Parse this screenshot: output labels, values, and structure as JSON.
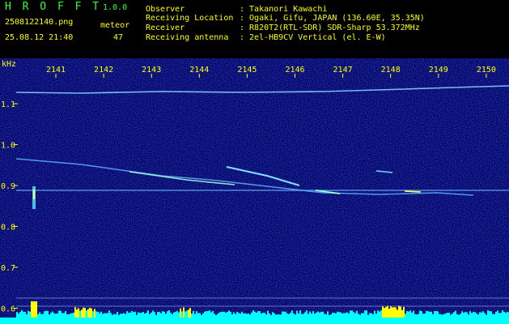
{
  "app": {
    "name": "H R O F F T",
    "version": "1.0.0",
    "file": "2508122140.png",
    "datetime": "25.08.12 21:40",
    "counter_label": "meteor",
    "counter_value": "47"
  },
  "info": [
    {
      "label": "Observer",
      "value": ": Takanori Kawachi"
    },
    {
      "label": "Receiving Location",
      "value": ": Ogaki, Gifu, JAPAN (136.60E, 35.35N)"
    },
    {
      "label": "Receiver",
      "value": ": R820T2(RTL-SDR) SDR-Sharp 53.372MHz"
    },
    {
      "label": "Receiving antenna",
      "value": ": 2el-HB9CV Vertical (el. E-W)"
    }
  ],
  "axis": {
    "unit": "kHz",
    "y_ticks": [
      "1.1",
      "1.0",
      "0.9",
      "0.8",
      "0.7",
      "0.6"
    ],
    "x_ticks": [
      "2141",
      "2142",
      "2143",
      "2144",
      "2145",
      "2146",
      "2147",
      "2148",
      "2149",
      "2150"
    ]
  },
  "colors": {
    "background": "#00005a",
    "header_text": "#ffff00",
    "title": "#33ff33",
    "level": "#00ffff",
    "level_peaks": "#ffff00"
  }
}
